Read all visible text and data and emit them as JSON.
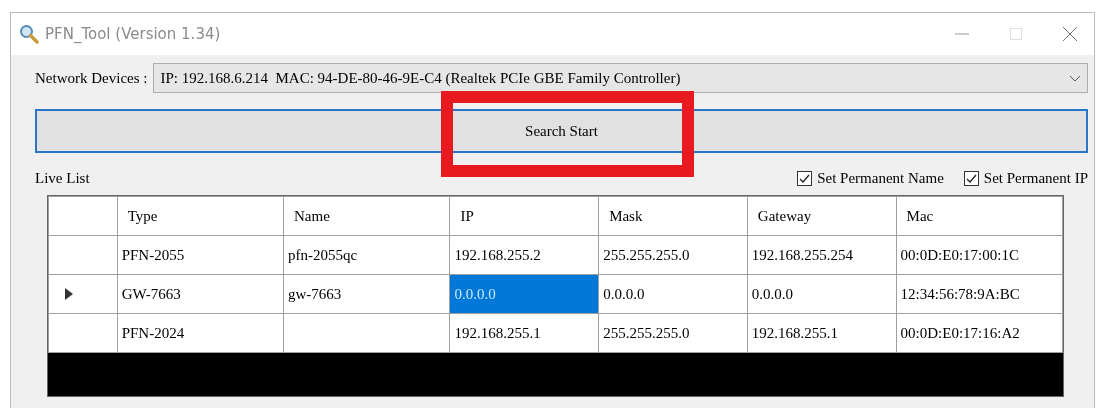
{
  "window": {
    "title": "PFN_Tool (Version 1.34)"
  },
  "network_devices": {
    "label": "Network Devices :",
    "value": "IP: 192.168.6.214  MAC: 94-DE-80-46-9E-C4 (Realtek PCIe GBE Family Controller)"
  },
  "search_button": {
    "label": "Search Start",
    "highlighted": true
  },
  "live_list": {
    "title": "Live List",
    "options": [
      {
        "label": "Set Permanent Name",
        "checked": true
      },
      {
        "label": "Set Permanent IP",
        "checked": true
      }
    ],
    "columns": [
      "Type",
      "Name",
      "IP",
      "Mask",
      "Gateway",
      "Mac"
    ],
    "rows": [
      {
        "selected": false,
        "cells": [
          {
            "text": "PFN-2055",
            "selected": false
          },
          {
            "text": "pfn-2055qc",
            "selected": false
          },
          {
            "text": "192.168.255.2",
            "selected": false
          },
          {
            "text": "255.255.255.0",
            "selected": false
          },
          {
            "text": "192.168.255.254",
            "selected": false
          },
          {
            "text": "00:0D:E0:17:00:1C",
            "selected": false
          }
        ]
      },
      {
        "selected": true,
        "cells": [
          {
            "text": "GW-7663",
            "selected": false
          },
          {
            "text": "gw-7663",
            "selected": false
          },
          {
            "text": "0.0.0.0",
            "selected": true
          },
          {
            "text": "0.0.0.0",
            "selected": false
          },
          {
            "text": "0.0.0.0",
            "selected": false
          },
          {
            "text": "12:34:56:78:9A:BC",
            "selected": false
          }
        ]
      },
      {
        "selected": false,
        "cells": [
          {
            "text": "PFN-2024",
            "selected": false
          },
          {
            "selected": false
          },
          {
            "text": "192.168.255.1",
            "selected": false
          },
          {
            "text": "255.255.255.0",
            "selected": false
          },
          {
            "text": "192.168.255.1",
            "selected": false
          },
          {
            "text": "00:0D:E0:17:16:A2",
            "selected": false
          }
        ]
      }
    ]
  }
}
